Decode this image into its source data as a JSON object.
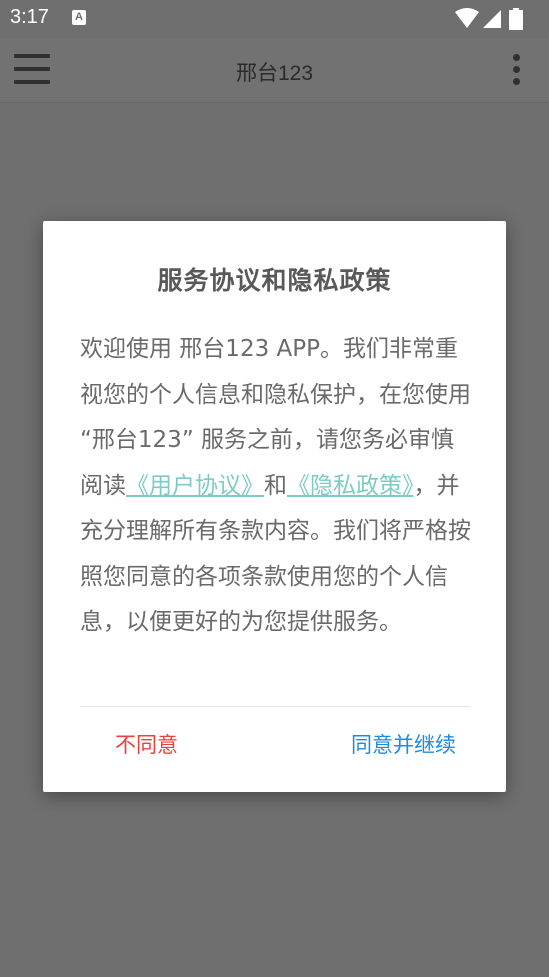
{
  "status_bar": {
    "time": "3:17",
    "notification_icon_letter": "A",
    "icons": [
      "a-notification-icon",
      "wifi-icon",
      "signal-icon",
      "battery-icon"
    ]
  },
  "app_bar": {
    "title": "邢台123",
    "menu_icon": "hamburger-menu-icon",
    "more_icon": "more-vertical-icon"
  },
  "dialog": {
    "title": "服务协议和隐私政策",
    "body": {
      "text_1": "欢迎使用 邢台123 APP。我们非常重视您的个人信息和隐私保护，在您使用 “邢台123” 服务之前，请您务必审慎阅读",
      "link_user_agreement": "《用户协议》",
      "text_2": "和",
      "link_privacy_policy": "《隐私政策》",
      "text_3": "，并充分理解所有条款内容。我们将严格按照您同意的各项条款使用您的个人信息，以便更好的为您提供服务。"
    },
    "buttons": {
      "disagree": "不同意",
      "agree": "同意并继续"
    }
  },
  "colors": {
    "overlay_background": "#6f6f6f",
    "link": "#7ecbc6",
    "disagree": "#e8413a",
    "agree": "#1f8be0",
    "dialog_background": "#ffffff"
  }
}
